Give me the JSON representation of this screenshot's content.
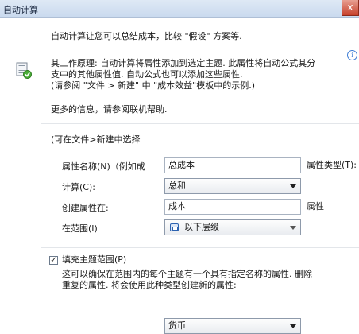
{
  "window": {
    "title": "自动计算",
    "close_glyph": "x"
  },
  "intro": "自动计算让您可以总结成本，比较 \"假设\" 方案等.",
  "principle": {
    "line1": "其工作原理: 自动计算将属性添加到选定主题. 此属性将自动公式其分",
    "line2": "支中的其他属性值. 自动公式也可以添加这些属性.",
    "line3": "(请参阅 \"文件 > 新建\" 中 \"成本效益\"模板中的示例.)"
  },
  "more_info": "更多的信息，请参阅联机帮助.",
  "template_hint": "(可在文件>新建中选择",
  "form": {
    "property_name_label": "属性名称(N)（例如成",
    "property_name_value": "总成本",
    "property_type_label": "属性类型(T):",
    "calc_label": "计算(C):",
    "calc_value": "总和",
    "create_label": "创建属性在:",
    "create_value": "成本",
    "create_suffix": "属性",
    "scope_label": "在范围(I)",
    "scope_value": "以下层级"
  },
  "fill_scope": {
    "label": "填充主题范围(P)",
    "checked": true,
    "desc_line1": "这可以确保在范围内的每个主题有一个具有指定名称的属性. 删除",
    "desc_line2": "重复的属性. 将会使用此种类型创建新的属性:"
  },
  "currency_select": {
    "value": "货币"
  },
  "icons": {
    "doc": "document-calc-icon",
    "info": "info-icon",
    "scope": "hierarchy-icon"
  }
}
